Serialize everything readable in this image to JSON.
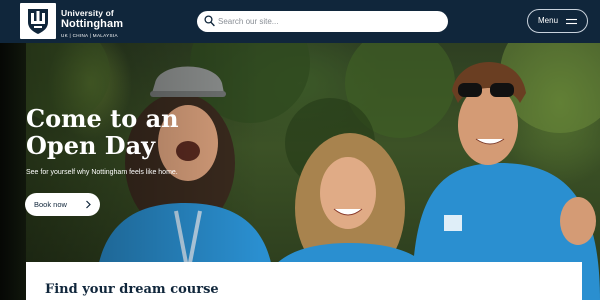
{
  "header": {
    "logo": {
      "line1": "University of",
      "line2": "Nottingham",
      "line3": "UK | CHINA | MALAYSIA",
      "icon": "crest-icon"
    },
    "search": {
      "placeholder": "Search our site...",
      "value": "",
      "icon": "search-icon"
    },
    "menu": {
      "label": "Menu",
      "icon": "hamburger-icon"
    }
  },
  "hero": {
    "title": "Come to an Open Day",
    "subtitle": "See for yourself why Nottingham feels like home.",
    "cta": {
      "label": "Book now",
      "icon": "chevron-right-icon"
    }
  },
  "card": {
    "title": "Find your dream course"
  },
  "colors": {
    "brand_navy": "#10263b",
    "shirt_blue": "#2a8fd0",
    "white": "#ffffff"
  }
}
